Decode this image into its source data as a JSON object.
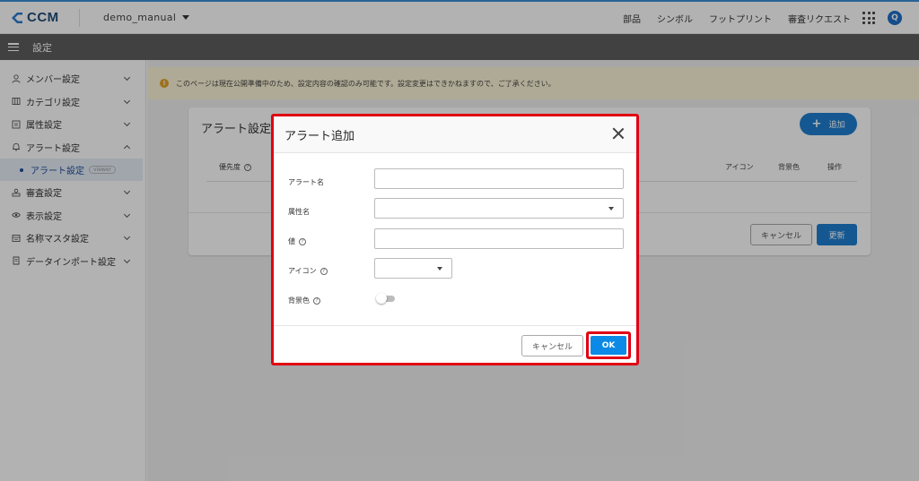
{
  "header": {
    "logo_text": "CCM",
    "project_name": "demo_manual",
    "nav": [
      "部品",
      "シンボル",
      "フットプリント",
      "審査リクエスト"
    ],
    "user_initial": "Q"
  },
  "subheader": {
    "title": "設定"
  },
  "sidebar": {
    "items": [
      {
        "label": "メンバー設定",
        "icon": "user-icon"
      },
      {
        "label": "カテゴリ設定",
        "icon": "category-icon"
      },
      {
        "label": "属性設定",
        "icon": "attribute-icon"
      },
      {
        "label": "アラート設定",
        "icon": "bell-icon"
      },
      {
        "label": "審査設定",
        "icon": "review-icon"
      },
      {
        "label": "表示設定",
        "icon": "eye-icon"
      },
      {
        "label": "名称マスタ設定",
        "icon": "master-icon"
      },
      {
        "label": "データインポート設定",
        "icon": "import-icon"
      }
    ],
    "active_sub": {
      "label": "アラート設定",
      "badge": "viewer"
    }
  },
  "notice": {
    "icon": "info-icon",
    "text": "このページは現在公開準備中のため、設定内容の確認のみ可能です。設定変更はできかねますので、ご了承ください。"
  },
  "card": {
    "title": "アラート設定",
    "add_label": "追加",
    "columns": {
      "priority": "優先度",
      "icon": "アイコン",
      "background": "背景色",
      "operation": "操作"
    },
    "cancel_label": "キャンセル",
    "update_label": "更新"
  },
  "modal": {
    "title": "アラート追加",
    "fields": {
      "alert_name": "アラート名",
      "attribute_name": "属性名",
      "value": "値",
      "icon": "アイコン",
      "background": "背景色"
    },
    "values": {
      "alert_name": "",
      "attribute_name": "",
      "value": "",
      "icon": ""
    },
    "background_toggle": "off",
    "cancel_label": "キャンセル",
    "ok_label": "OK"
  },
  "colors": {
    "primary": "#1f7fd0",
    "ok": "#0a8ae6",
    "highlight": "#e00012",
    "notice_bg": "#fbf4d6",
    "subbar": "#5e5e5e"
  }
}
